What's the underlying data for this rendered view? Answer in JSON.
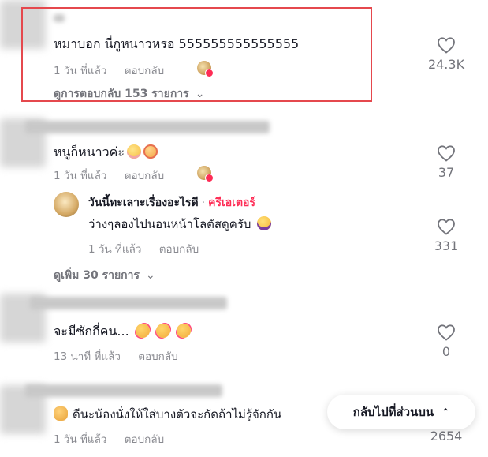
{
  "comments": [
    {
      "text": "หมาบอก นี่กูหนาวหรอ 555555555555555",
      "time": "1 วัน ที่แล้ว",
      "reply": "ตอบกลับ",
      "likes": "24.3K",
      "view_replies": "ดูการตอบกลับ 153 รายการ"
    },
    {
      "text": "หนูก็หนาวค่ะ",
      "time": "1 วัน ที่แล้ว",
      "reply": "ตอบกลับ",
      "likes": "37"
    },
    {
      "text": "จะมีซักกี่คน...",
      "time": "13 นาที ที่แล้ว",
      "reply": "ตอบกลับ",
      "likes": "0"
    },
    {
      "text": "ดีนะน้องนั่งให้ใส่บางตัวจะกัดถ้าไม่รู้จักกัน",
      "time": "1 วัน ที่แล้ว",
      "reply": "ตอบกลับ",
      "likes": "2654"
    }
  ],
  "creator_reply": {
    "name": "วันนี้ทะเลาะเรื่องอะไรดี",
    "separator": "·",
    "badge": "ครีเอเตอร์",
    "text": "ว่างๆลองไปนอนหน้าโลตัสดูครับ",
    "time": "1 วัน ที่แล้ว",
    "reply": "ตอบกลับ",
    "likes": "331",
    "view_more": "ดูเพิ่ม 30 รายการ"
  },
  "back_to_top": "กลับไปที่ส่วนบน",
  "icons": {
    "like": "heart-outline-icon",
    "expand": "chevron-down-icon",
    "back_top": "double-chevron-up-icon"
  },
  "colors": {
    "highlight": "#e5484d",
    "creator": "#fe2c55",
    "meta": "#8a8b91"
  }
}
